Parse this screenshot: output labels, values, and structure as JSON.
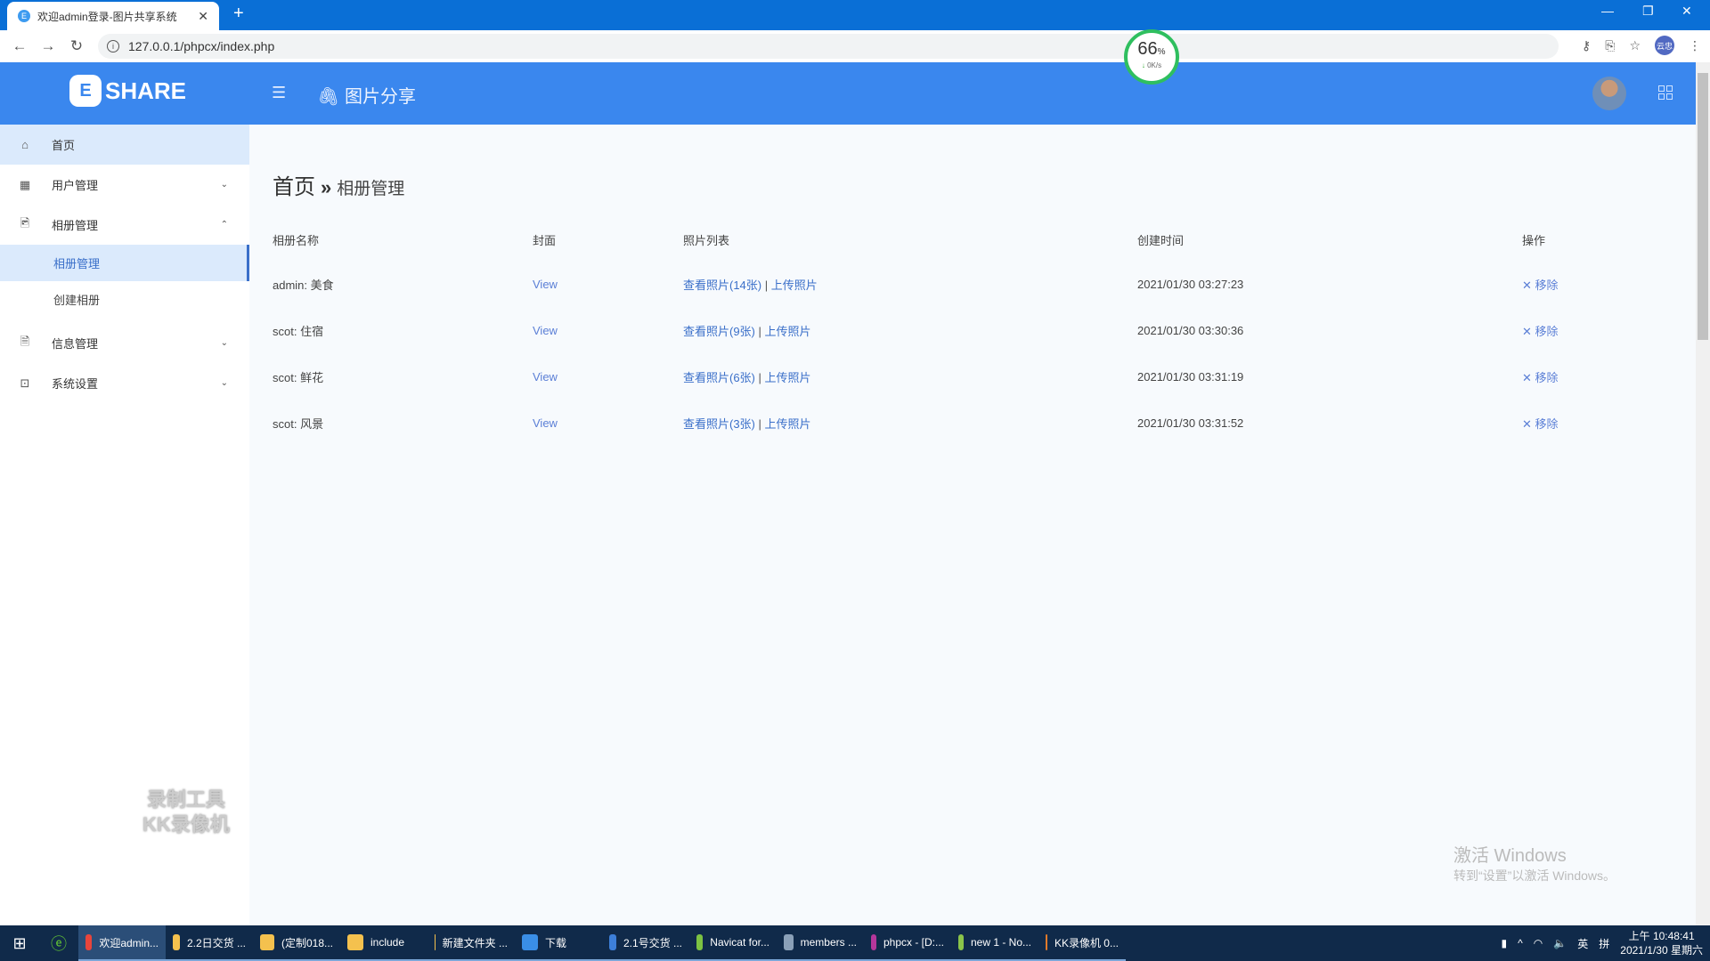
{
  "browser": {
    "tab_title": "欢迎admin登录-图片共享系统",
    "tab_favicon": "E",
    "new_tab": "+",
    "url": "127.0.0.1/phpcx/index.php",
    "profile": "云忠",
    "controls": {
      "minimize": "—",
      "restore": "❐",
      "close": "✕"
    },
    "nav": {
      "back": "←",
      "forward": "→",
      "reload": "↻"
    }
  },
  "speed_widget": {
    "percent": "66",
    "unit": "%",
    "rate": "0K/s"
  },
  "header": {
    "logo_letter": "E",
    "logo_text": "SHARE",
    "menu_icon": "☰",
    "title_icon": "paperclip-icon",
    "title": "图片分享"
  },
  "sidebar": {
    "items": [
      {
        "label": "首页",
        "icon": "⌂"
      },
      {
        "label": "用户管理",
        "icon": "▦",
        "chevron": "⌄"
      },
      {
        "label": "相册管理",
        "icon": "🖻",
        "chevron": "⌃",
        "expanded": true,
        "children": [
          {
            "label": "相册管理",
            "active": true
          },
          {
            "label": "创建相册"
          }
        ]
      },
      {
        "label": "信息管理",
        "icon": "🗎",
        "chevron": "⌄"
      },
      {
        "label": "系统设置",
        "icon": "⊡",
        "chevron": "⌄"
      }
    ]
  },
  "breadcrumb": {
    "home": "首页",
    "separator": "»",
    "current": "相册管理"
  },
  "table": {
    "headers": [
      "相册名称",
      "封面",
      "照片列表",
      "创建时间",
      "操作"
    ],
    "rows": [
      {
        "name": "admin: 美食",
        "cover": "View",
        "view_photos": "查看照片(14张)",
        "divider": "|",
        "upload": "上传照片",
        "created": "2021/01/30 03:27:23",
        "action": "✕ 移除"
      },
      {
        "name": "scot: 住宿",
        "cover": "View",
        "view_photos": "查看照片(9张)",
        "divider": "|",
        "upload": "上传照片",
        "created": "2021/01/30 03:30:36",
        "action": "✕ 移除"
      },
      {
        "name": "scot: 鲜花",
        "cover": "View",
        "view_photos": "查看照片(6张)",
        "divider": "|",
        "upload": "上传照片",
        "created": "2021/01/30 03:31:19",
        "action": "✕ 移除"
      },
      {
        "name": "scot: 风景",
        "cover": "View",
        "view_photos": "查看照片(3张)",
        "divider": "|",
        "upload": "上传照片",
        "created": "2021/01/30 03:31:52",
        "action": "✕ 移除"
      }
    ]
  },
  "overlays": {
    "recorder_line1": "录制工具",
    "recorder_line2": "KK录像机",
    "activate_title": "激活 Windows",
    "activate_sub": "转到“设置”以激活 Windows。"
  },
  "taskbar": {
    "items": [
      {
        "label": "欢迎admin...",
        "color": "#e8453c",
        "active": true
      },
      {
        "label": "2.2日交货 ...",
        "color": "#f4c14e"
      },
      {
        "label": "(定制018...",
        "color": "#f4c14e"
      },
      {
        "label": "include",
        "color": "#f4c14e"
      },
      {
        "label": "新建文件夹 ...",
        "color": "#f4c14e"
      },
      {
        "label": "下载",
        "color": "#3a8ee6"
      },
      {
        "label": "2.1号交货 ...",
        "color": "#3d7fd9"
      },
      {
        "label": "Navicat for...",
        "color": "#7cc242"
      },
      {
        "label": "members ...",
        "color": "#8aa0b8"
      },
      {
        "label": "phpcx - [D:...",
        "color": "#b5379b"
      },
      {
        "label": "new 1 - No...",
        "color": "#8ac44a"
      },
      {
        "label": "KK录像机 0...",
        "color": "#e07a2a"
      }
    ],
    "tray": {
      "ime": "英",
      "ime2": "拼",
      "time": "上午 10:48:41",
      "date": "2021/1/30 星期六"
    }
  },
  "colors": {
    "accent": "#3a87ee",
    "tabbar": "#0a6fd6",
    "link": "#5b7fd6",
    "active_bg": "#dbeafc"
  }
}
